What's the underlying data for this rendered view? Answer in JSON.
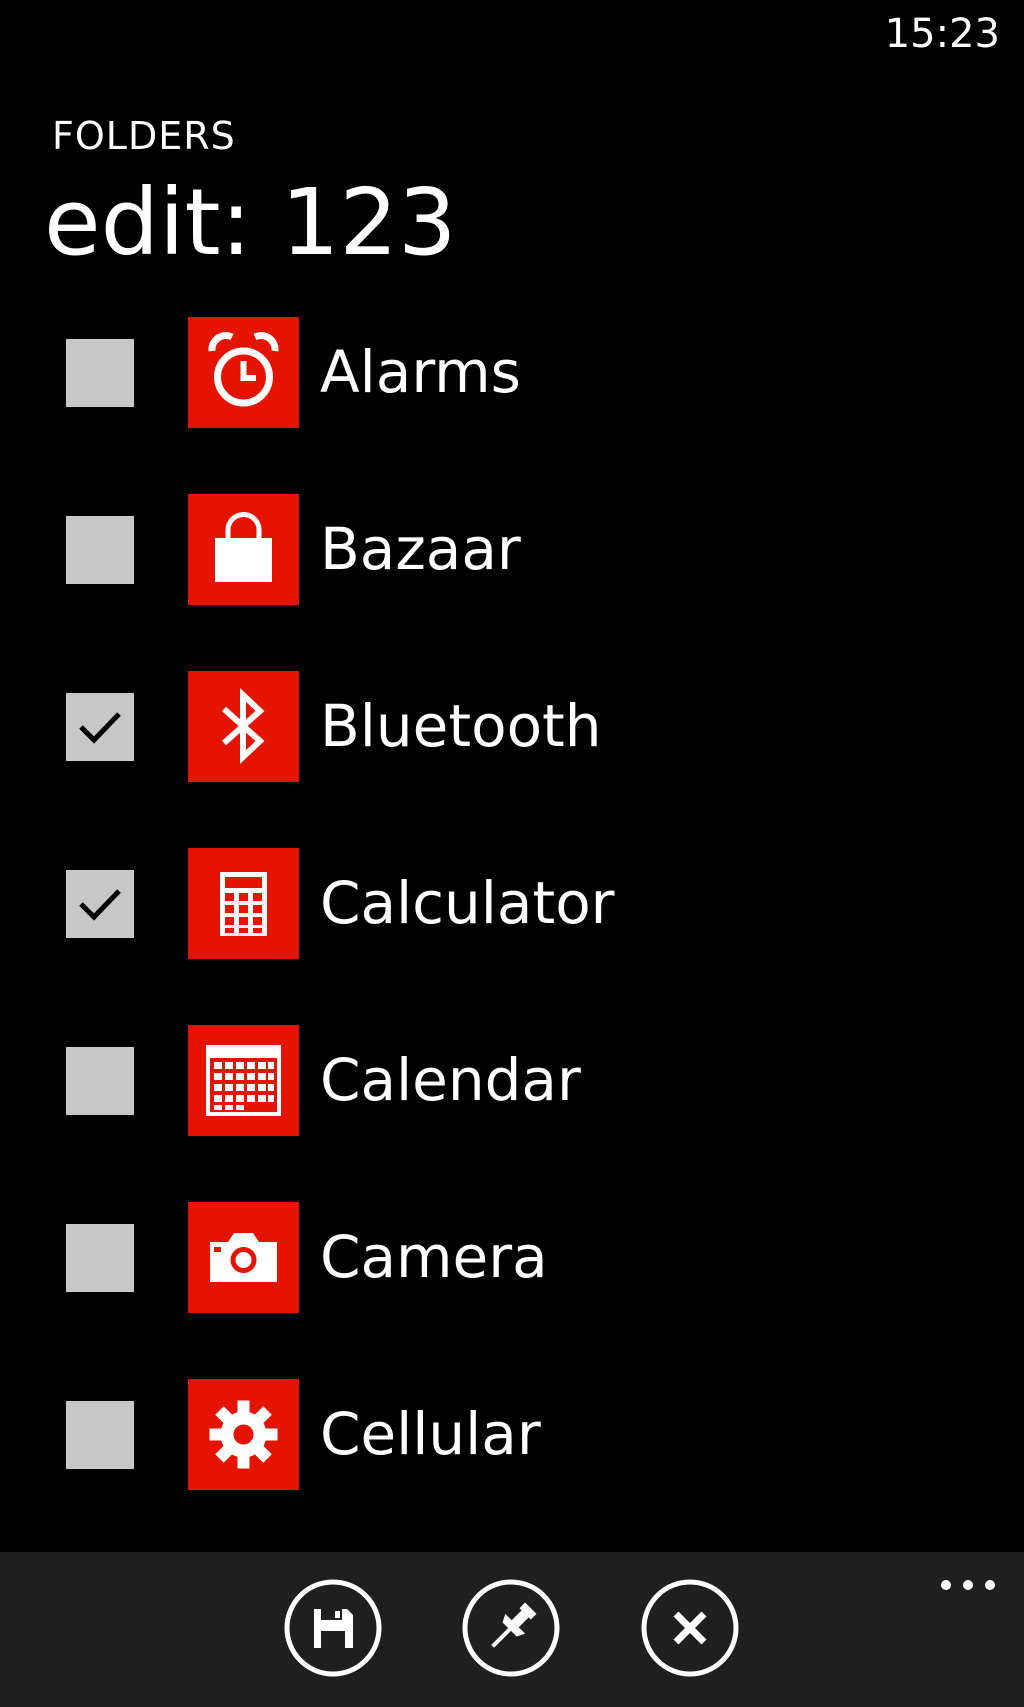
{
  "status_bar": {
    "time": "15:23"
  },
  "header": {
    "app_title": "FOLDERS",
    "page_title": "edit: 123"
  },
  "accent_color": "#e51400",
  "items": [
    {
      "label": "Alarms",
      "icon": "alarm-clock-icon",
      "checked": false
    },
    {
      "label": "Bazaar",
      "icon": "shopping-bag-icon",
      "checked": false
    },
    {
      "label": "Bluetooth",
      "icon": "bluetooth-icon",
      "checked": true
    },
    {
      "label": "Calculator",
      "icon": "calculator-icon",
      "checked": true
    },
    {
      "label": "Calendar",
      "icon": "calendar-icon",
      "checked": false
    },
    {
      "label": "Camera",
      "icon": "camera-icon",
      "checked": false
    },
    {
      "label": "Cellular",
      "icon": "gear-icon",
      "checked": false
    }
  ],
  "app_bar": {
    "buttons": [
      {
        "name": "save",
        "icon": "save-icon"
      },
      {
        "name": "pin",
        "icon": "pin-icon"
      },
      {
        "name": "cancel",
        "icon": "close-icon"
      }
    ],
    "more_icon": "more-dots-icon"
  }
}
